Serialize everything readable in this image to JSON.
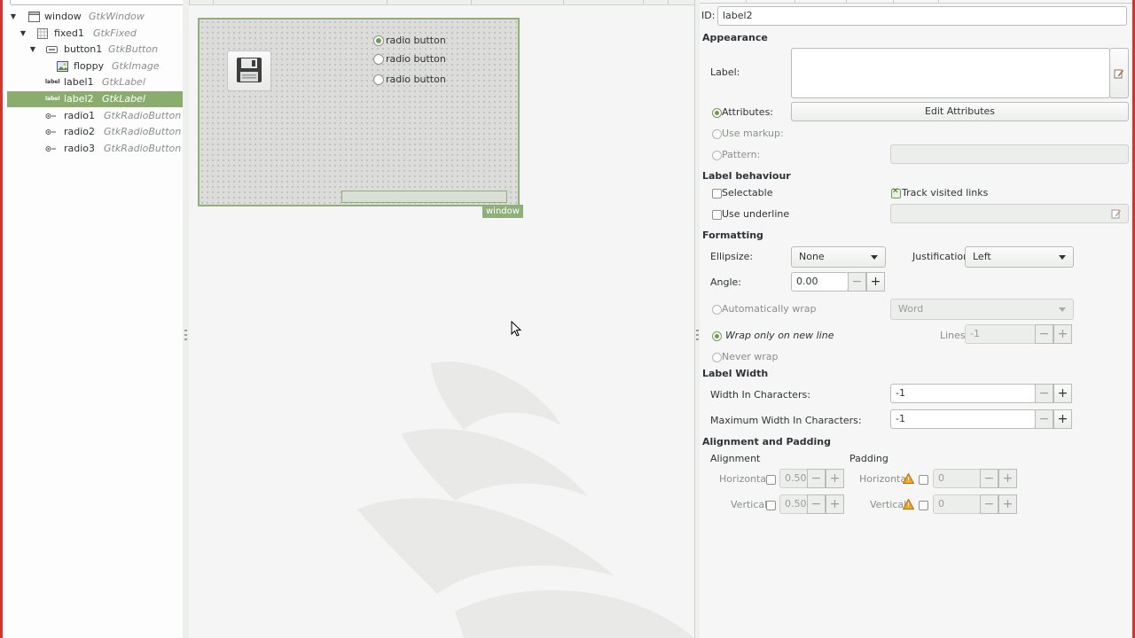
{
  "tree": {
    "rows": [
      {
        "name": "window",
        "class": "GtkWindow",
        "icon": "window-icon",
        "expander": "expanded"
      },
      {
        "name": "fixed1",
        "class": "GtkFixed",
        "icon": "fixed-container-icon",
        "expander": "expanded"
      },
      {
        "name": "button1",
        "class": "GtkButton",
        "icon": "button-icon",
        "expander": "expanded"
      },
      {
        "name": "floppy",
        "class": "GtkImage",
        "icon": "image-icon",
        "expander": "none"
      },
      {
        "name": "label1",
        "class": "GtkLabel",
        "icon": "label-icon",
        "expander": "none"
      },
      {
        "name": "label2",
        "class": "GtkLabel",
        "icon": "label-icon",
        "expander": "none",
        "selected": true
      },
      {
        "name": "radio1",
        "class": "GtkRadioButton",
        "icon": "radio-button-icon",
        "expander": "none"
      },
      {
        "name": "radio2",
        "class": "GtkRadioButton",
        "icon": "radio-button-icon",
        "expander": "none"
      },
      {
        "name": "radio3",
        "class": "GtkRadioButton",
        "icon": "radio-button-icon",
        "expander": "none"
      }
    ],
    "label_icon_text": "label"
  },
  "canvas": {
    "radios": [
      {
        "label": "radio button",
        "checked": true
      },
      {
        "label": "radio button",
        "checked": false
      },
      {
        "label": "radio button",
        "checked": false
      }
    ],
    "window_tag": "window",
    "button_icon": "floppy-disk-icon"
  },
  "props": {
    "id_label": "ID:",
    "id_value": "label2",
    "appearance": {
      "title": "Appearance",
      "label_label": "Label:",
      "label_value": "",
      "attributes_label": "Attributes:",
      "edit_attributes": "Edit Attributes",
      "use_markup_label": "Use markup:",
      "pattern_label": "Pattern:"
    },
    "behaviour": {
      "title": "Label behaviour",
      "selectable": "Selectable",
      "track_visited": "Track visited links",
      "track_visited_checked": true,
      "use_underline": "Use underline"
    },
    "formatting": {
      "title": "Formatting",
      "ellipsize_label": "Ellipsize:",
      "ellipsize_value": "None",
      "justification_label": "Justification:",
      "justification_value": "Left",
      "angle_label": "Angle:",
      "angle_value": "0.00",
      "auto_wrap": "Automatically wrap",
      "wrap_mode_value": "Word",
      "wrap_new_line": "Wrap only on new line",
      "lines_label": "Lines",
      "lines_value": "-1",
      "never_wrap": "Never wrap"
    },
    "width": {
      "title": "Label Width",
      "width_chars_label": "Width In Characters:",
      "width_chars_value": "-1",
      "max_width_label": "Maximum Width In Characters:",
      "max_width_value": "-1"
    },
    "alignment": {
      "title": "Alignment and Padding",
      "alignment_label": "Alignment",
      "padding_label": "Padding",
      "horizontal": "Horizontal",
      "vertical": "Vertical",
      "xalign": "0.50",
      "yalign": "0.50",
      "xpad": "0",
      "ypad": "0"
    },
    "minus": "−",
    "plus": "+"
  },
  "colors": {
    "selection": "#8aad6e",
    "frame": "#d4332f",
    "accent": "#6f9b53"
  }
}
